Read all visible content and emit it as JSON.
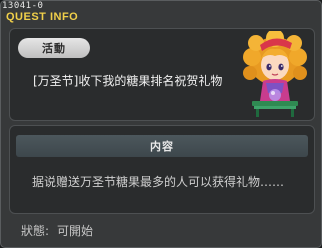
{
  "window": {
    "quest_id": "13041-0",
    "title": "QUEST INFO"
  },
  "quest": {
    "category_label": "活動",
    "name": "[万圣节]收下我的糖果排名祝贺礼物",
    "npc_icon": "npc-girl-portrait-icon"
  },
  "details": {
    "section_label": "内容",
    "description": "据说赠送万圣节糖果最多的人可以获得礼物……"
  },
  "status": {
    "label": "狀態:",
    "value": "可開始"
  },
  "colors": {
    "title_accent": "#f1d04a",
    "window_bg": "#37393a",
    "panel_bg": "#2a2c2d"
  }
}
